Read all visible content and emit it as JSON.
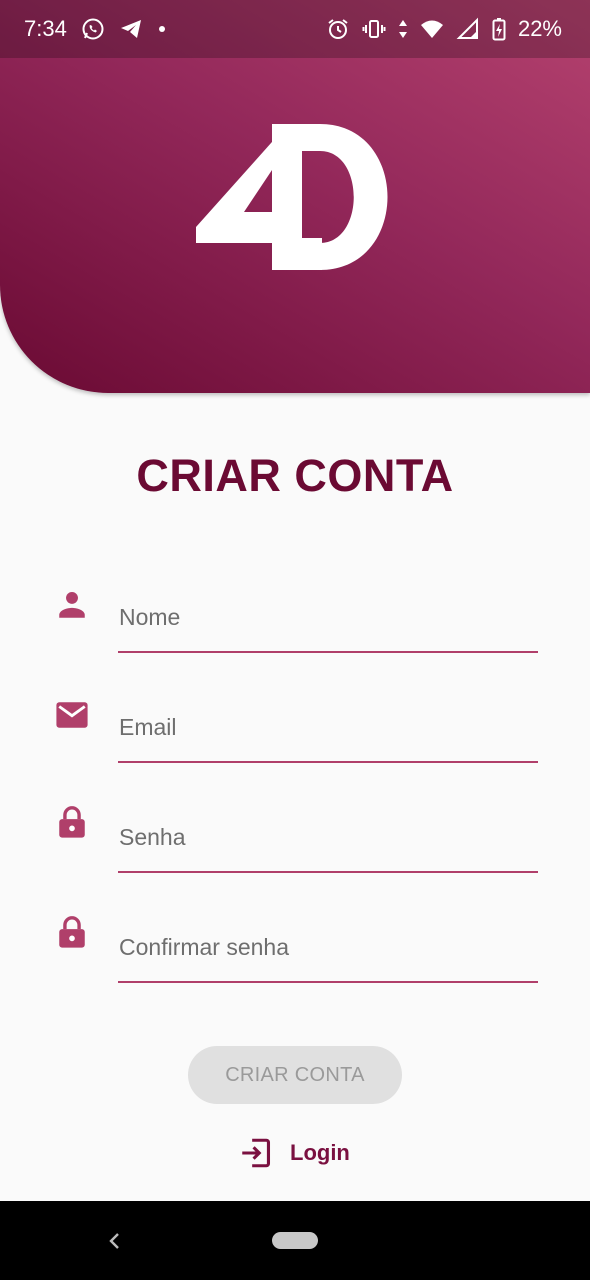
{
  "status_bar": {
    "time": "7:34",
    "battery": "22%",
    "network_type": "4"
  },
  "logo": {
    "text": "4D"
  },
  "page": {
    "title": "CRIAR CONTA"
  },
  "form": {
    "fields": [
      {
        "icon": "person-icon",
        "placeholder": "Nome"
      },
      {
        "icon": "email-icon",
        "placeholder": "Email"
      },
      {
        "icon": "lock-icon",
        "placeholder": "Senha"
      },
      {
        "icon": "lock-icon",
        "placeholder": "Confirmar senha"
      }
    ],
    "submit_label": "CRIAR CONTA",
    "login_label": "Login"
  },
  "colors": {
    "primary": "#6b0a33",
    "accent": "#b03f6a",
    "button_disabled_bg": "#e0e0e0",
    "button_disabled_text": "#9a9a9a"
  }
}
